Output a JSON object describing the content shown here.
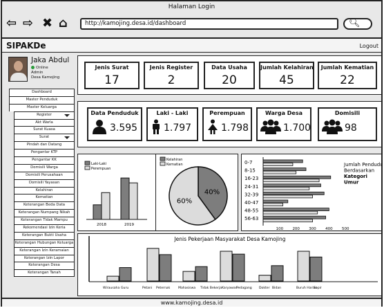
{
  "window": {
    "title": "Halaman Login"
  },
  "browser": {
    "url": "http://kamojing.desa.id/dashboard"
  },
  "app": {
    "brand": "SIPAKDe",
    "logout": "Logout"
  },
  "profile": {
    "name": "Jaka Abdul",
    "status": "Online",
    "role": "Admin",
    "org": "Desa Kamojing"
  },
  "menu": [
    {
      "label": "Dashboard",
      "sub": false,
      "caret": false
    },
    {
      "label": "Master Penduduk",
      "sub": false,
      "caret": false
    },
    {
      "label": "Master Keluarga",
      "sub": false,
      "caret": false
    },
    {
      "label": "Register",
      "sub": true,
      "caret": true
    },
    {
      "label": "Akt Warla",
      "sub": true,
      "caret": false
    },
    {
      "label": "Surat Kuasa",
      "sub": true,
      "caret": false
    },
    {
      "label": "Surat",
      "sub": true,
      "caret": true
    },
    {
      "label": "Pindah dan Datang",
      "sub": true,
      "caret": false
    },
    {
      "label": "Pengantar KTP",
      "sub": true,
      "caret": false
    },
    {
      "label": "Pengantar KK",
      "sub": true,
      "caret": false
    },
    {
      "label": "Domisili Warga",
      "sub": true,
      "caret": false
    },
    {
      "label": "Domisili Perusahaan",
      "sub": true,
      "caret": false
    },
    {
      "label": "Domisili Yayasan",
      "sub": true,
      "caret": false
    },
    {
      "label": "Kelahiran",
      "sub": true,
      "caret": false
    },
    {
      "label": "Kematian",
      "sub": true,
      "caret": false
    },
    {
      "label": "Keterangan Beda Data",
      "sub": true,
      "caret": false
    },
    {
      "label": "Keterangan Numpang Nikah",
      "sub": true,
      "caret": false
    },
    {
      "label": "Keterangan Tidak Mampu",
      "sub": true,
      "caret": false
    },
    {
      "label": "Rekomendasi Izin Keria",
      "sub": true,
      "caret": false
    },
    {
      "label": "Keterangan Bukti Usaha",
      "sub": true,
      "caret": false
    },
    {
      "label": "Keterangan Hubungan Keluarga",
      "sub": true,
      "caret": false
    },
    {
      "label": "Keterangan Izin Keramaian",
      "sub": true,
      "caret": false
    },
    {
      "label": "Keterangan Izin Lapor",
      "sub": true,
      "caret": false
    },
    {
      "label": "Keterangan Desa",
      "sub": true,
      "caret": false
    },
    {
      "label": "Keterangan Tanah",
      "sub": true,
      "caret": false
    }
  ],
  "stats_top": [
    {
      "label": "Jenis Surat",
      "value": "17"
    },
    {
      "label": "Jenis Register",
      "value": "2"
    },
    {
      "label": "Data Usaha",
      "value": "20"
    },
    {
      "label": "Jumlah Kelahiran",
      "value": "45"
    },
    {
      "label": "Jumlah Kematian",
      "value": "22"
    }
  ],
  "stats_pop": [
    {
      "label": "Data Penduduk",
      "value": "3.595",
      "icon": "person-icon"
    },
    {
      "label": "Laki - Laki",
      "value": "1.797",
      "icon": "male-icon"
    },
    {
      "label": "Perempuan",
      "value": "1.798",
      "icon": "female-icon"
    },
    {
      "label": "Warga Desa",
      "value": "1.700",
      "icon": "group-icon"
    },
    {
      "label": "Domisili",
      "value": "98",
      "icon": "group-icon"
    }
  ],
  "colors": {
    "dark": "#7d7d7d",
    "light": "#dcdcdc"
  },
  "chart_data": [
    {
      "type": "bar",
      "categories": [
        "2018",
        "2019"
      ],
      "series": [
        {
          "name": "Laki-Laki",
          "values": [
            24,
            68
          ]
        },
        {
          "name": "Perempuan",
          "values": [
            44,
            60
          ]
        }
      ],
      "ylim": [
        0,
        75
      ]
    },
    {
      "type": "pie",
      "labels": [
        "Kelahiran",
        "Kematian"
      ],
      "values": [
        40,
        60
      ],
      "value_labels": [
        "40%",
        "60%"
      ]
    },
    {
      "type": "bar",
      "orientation": "horizontal",
      "title": "Jumlah Penduduk Berdasarkan Kategori Umur",
      "title_lines": [
        "Jumlah Penduduk",
        "Berdasarkan",
        "Kategori",
        "Umur"
      ],
      "categories": [
        "0-7",
        "8-15",
        "16-23",
        "24-31",
        "32-39",
        "40-47",
        "48-55",
        "56-63"
      ],
      "series": [
        {
          "values": [
            240,
            260,
            410,
            350,
            370,
            150,
            400,
            380
          ]
        },
        {
          "values": [
            180,
            200,
            340,
            280,
            300,
            120,
            330,
            300
          ]
        }
      ],
      "xticks": [
        100,
        200,
        300,
        400,
        500
      ],
      "xlim": [
        0,
        520
      ]
    },
    {
      "type": "bar",
      "title": "Jenis Pekerjaan Masyarakat Desa Kamojing",
      "categories": [
        "Wirausaha",
        "Guru",
        "Petani",
        "Peternak",
        "Mahasiswa",
        "Tidak Bekerja",
        "Karyawan",
        "Pedagang",
        "Dokter",
        "Bidan",
        "Buruh Harian",
        "Sopir"
      ],
      "values": [
        10,
        28,
        68,
        55,
        20,
        30,
        62,
        56,
        12,
        32,
        62,
        50
      ],
      "ylim": [
        0,
        75
      ]
    }
  ]
}
